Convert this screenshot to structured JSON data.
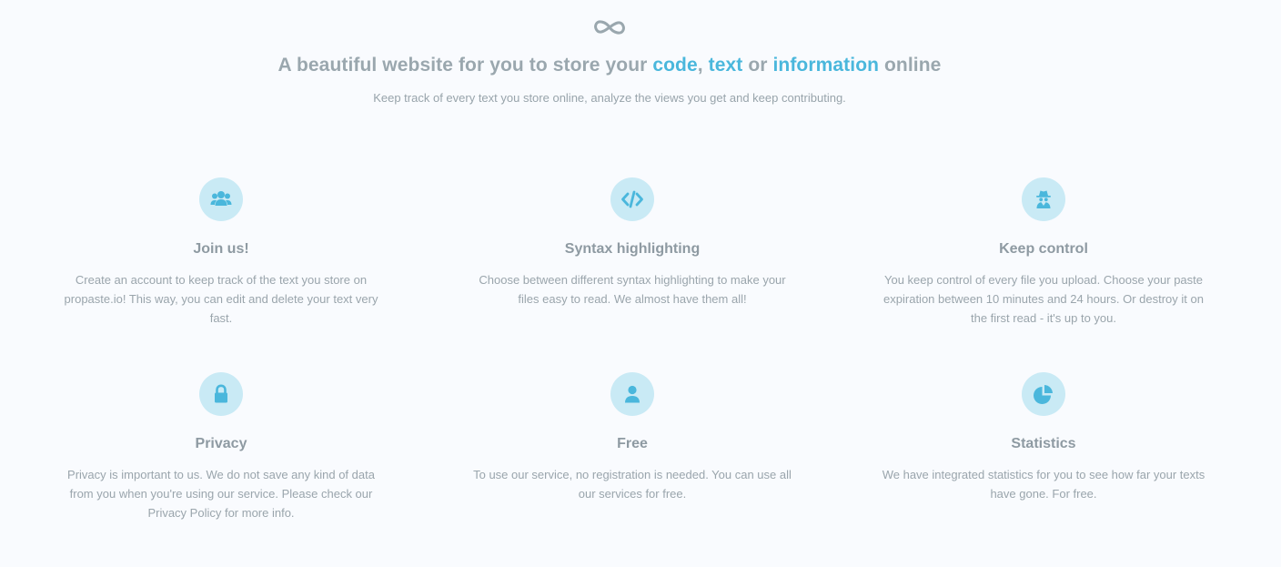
{
  "hero": {
    "logo_icon": "infinity-icon",
    "headline": {
      "part1": "A beautiful website for you to store your ",
      "highlight1": "code",
      "sep1": ", ",
      "highlight2": "text",
      "sep2": " or ",
      "highlight3": "information",
      "part2": " online"
    },
    "subline": "Keep track of every text you store online, analyze the views you get and keep contributing."
  },
  "features": [
    {
      "icon": "users-icon",
      "title": "Join us!",
      "text": "Create an account to keep track of the text you store on propaste.io! This way, you can edit and delete your text very fast."
    },
    {
      "icon": "code-icon",
      "title": "Syntax highlighting",
      "text": "Choose between different syntax highlighting to make your files easy to read. We almost have them all!"
    },
    {
      "icon": "spy-icon",
      "title": "Keep control",
      "text": "You keep control of every file you upload. Choose your paste expiration between 10 minutes and 24 hours. Or destroy it on the first read - it's up to you."
    },
    {
      "icon": "lock-icon",
      "title": "Privacy",
      "text": "Privacy is important to us. We do not save any kind of data from you when you're using our service. Please check our Privacy Policy for more info."
    },
    {
      "icon": "user-icon",
      "title": "Free",
      "text": "To use our service, no registration is needed. You can use all our services for free."
    },
    {
      "icon": "pie-chart-icon",
      "title": "Statistics",
      "text": "We have integrated statistics for you to see how far your texts have gone. For free."
    }
  ],
  "colors": {
    "accent": "#4ab7dc",
    "icon_bg": "#c9eaf5",
    "text": "#9aa5ac",
    "background": "#f9fbfe"
  }
}
